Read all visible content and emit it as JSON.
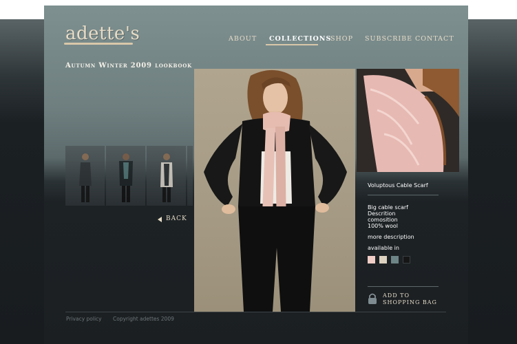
{
  "brand": {
    "logo_text": "adette's"
  },
  "nav": {
    "items": [
      {
        "label": "ABOUT"
      },
      {
        "label": "COLLECTIONS"
      },
      {
        "label": "SHOP"
      },
      {
        "label": "SUBSCRIBE"
      },
      {
        "label": "CONTACT"
      }
    ],
    "active": "COLLECTIONS"
  },
  "lookbook": {
    "title": "Autumn Winter 2009 lookbook",
    "back_label": "BACK"
  },
  "product": {
    "name": "Voluptous Cable Scarf",
    "description_lines": [
      "Big cable scarf",
      "Descrition",
      "comosition",
      "100% wool"
    ],
    "more_label": "more description",
    "available_label": "available in",
    "swatches": [
      {
        "color": "#f0cdc6"
      },
      {
        "color": "#ddd2bf"
      },
      {
        "color": "#6e8587"
      },
      {
        "color": "#161616"
      }
    ],
    "add_to_bag_line1": "ADD TO",
    "add_to_bag_line2": "SHOPPING BAG"
  },
  "footer": {
    "privacy": "Privacy policy",
    "copyright": "Copyright adettes 2009"
  },
  "colors": {
    "accent": "#d9c7a8",
    "page_top": "#7e9090",
    "page_bottom": "#1b1f22"
  },
  "icons": {
    "back": "triangle-left-icon",
    "bag": "padlock-bag-icon"
  }
}
